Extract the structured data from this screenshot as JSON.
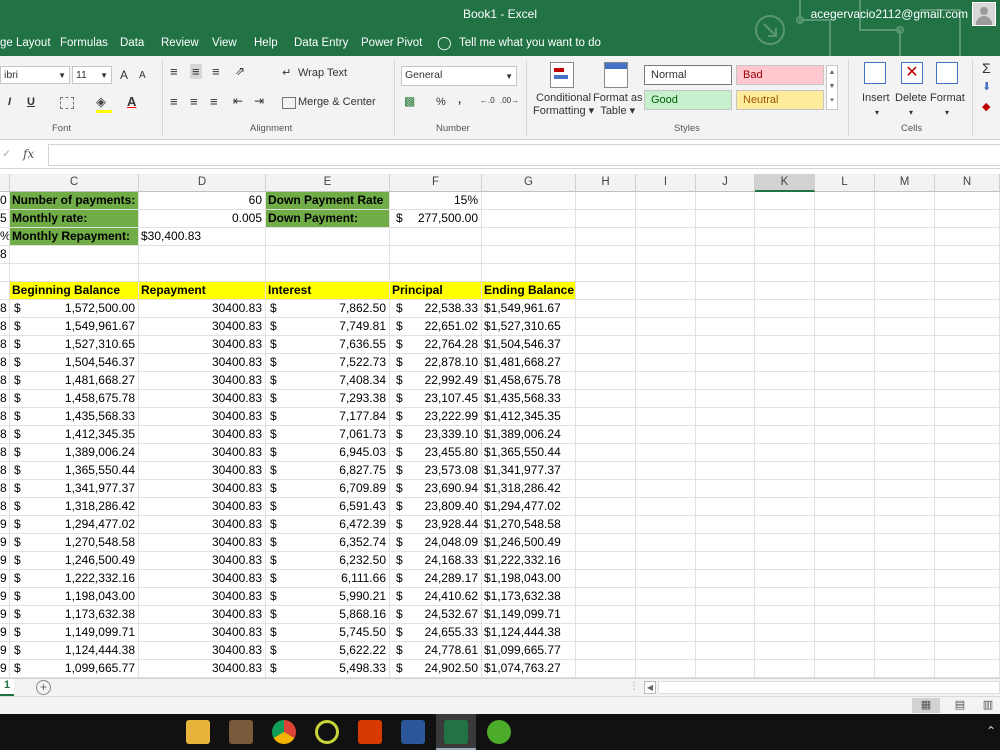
{
  "window": {
    "title": "Book1  -  Excel",
    "account": "acegervacio2112@gmail.com"
  },
  "tabs": [
    {
      "label": "ge Layout"
    },
    {
      "label": "Formulas"
    },
    {
      "label": "Data"
    },
    {
      "label": "Review"
    },
    {
      "label": "View"
    },
    {
      "label": "Help"
    },
    {
      "label": "Data Entry"
    },
    {
      "label": "Power Pivot"
    }
  ],
  "tell_me": "Tell me what you want to do",
  "ribbon": {
    "font_name": "ibri",
    "font_size": "11",
    "grow_font": "A",
    "shrink_font": "A",
    "bold": "I",
    "underline": "U",
    "wrap_text": "Wrap Text",
    "merge_center": "Merge & Center",
    "number_format": "General",
    "percent": "%",
    "comma": ",",
    "conditional_formatting": [
      "Conditional",
      "Formatting"
    ],
    "format_as_table": [
      "Format as",
      "Table"
    ],
    "styles": {
      "normal": "Normal",
      "bad": "Bad",
      "good": "Good",
      "neutral": "Neutral"
    },
    "insert": "Insert",
    "delete": "Delete",
    "format": "Format",
    "groups": {
      "font": "Font",
      "alignment": "Alignment",
      "number": "Number",
      "styles": "Styles",
      "cells": "Cells"
    }
  },
  "formula_bar": {
    "fx": "fx",
    "content": ""
  },
  "columns": [
    "C",
    "D",
    "E",
    "F",
    "G",
    "H",
    "I",
    "J",
    "K",
    "L",
    "M",
    "N"
  ],
  "selected_column": "K",
  "info": {
    "row1": {
      "b_tail": "0",
      "c": "Number of payments:",
      "d": "60",
      "e": "Down Payment Rate",
      "f": "15%"
    },
    "row2": {
      "b_tail": "5",
      "c": "Monthly rate:",
      "d": "0.005",
      "e": "Down Payment:",
      "f_sym": "$",
      "f": "277,500.00"
    },
    "row3": {
      "b_tail": "%",
      "c": "Monthly Repayment:",
      "d": "$30,400.83"
    },
    "row4": {
      "b_tail": "8"
    }
  },
  "table": {
    "headers": {
      "c": "Beginning Balance",
      "d": "Repayment",
      "e": "Interest",
      "f": "Principal",
      "g": "Ending Balance"
    },
    "rows": [
      {
        "b": "8",
        "begin": "1,572,500.00",
        "repay": "30400.83",
        "interest": "7,862.50",
        "principal": "22,538.33",
        "end": "$1,549,961.67"
      },
      {
        "b": "8",
        "begin": "1,549,961.67",
        "repay": "30400.83",
        "interest": "7,749.81",
        "principal": "22,651.02",
        "end": "$1,527,310.65"
      },
      {
        "b": "8",
        "begin": "1,527,310.65",
        "repay": "30400.83",
        "interest": "7,636.55",
        "principal": "22,764.28",
        "end": "$1,504,546.37"
      },
      {
        "b": "8",
        "begin": "1,504,546.37",
        "repay": "30400.83",
        "interest": "7,522.73",
        "principal": "22,878.10",
        "end": "$1,481,668.27"
      },
      {
        "b": "8",
        "begin": "1,481,668.27",
        "repay": "30400.83",
        "interest": "7,408.34",
        "principal": "22,992.49",
        "end": "$1,458,675.78"
      },
      {
        "b": "8",
        "begin": "1,458,675.78",
        "repay": "30400.83",
        "interest": "7,293.38",
        "principal": "23,107.45",
        "end": "$1,435,568.33"
      },
      {
        "b": "8",
        "begin": "1,435,568.33",
        "repay": "30400.83",
        "interest": "7,177.84",
        "principal": "23,222.99",
        "end": "$1,412,345.35"
      },
      {
        "b": "8",
        "begin": "1,412,345.35",
        "repay": "30400.83",
        "interest": "7,061.73",
        "principal": "23,339.10",
        "end": "$1,389,006.24"
      },
      {
        "b": "8",
        "begin": "1,389,006.24",
        "repay": "30400.83",
        "interest": "6,945.03",
        "principal": "23,455.80",
        "end": "$1,365,550.44"
      },
      {
        "b": "8",
        "begin": "1,365,550.44",
        "repay": "30400.83",
        "interest": "6,827.75",
        "principal": "23,573.08",
        "end": "$1,341,977.37"
      },
      {
        "b": "8",
        "begin": "1,341,977.37",
        "repay": "30400.83",
        "interest": "6,709.89",
        "principal": "23,690.94",
        "end": "$1,318,286.42"
      },
      {
        "b": "8",
        "begin": "1,318,286.42",
        "repay": "30400.83",
        "interest": "6,591.43",
        "principal": "23,809.40",
        "end": "$1,294,477.02"
      },
      {
        "b": "9",
        "begin": "1,294,477.02",
        "repay": "30400.83",
        "interest": "6,472.39",
        "principal": "23,928.44",
        "end": "$1,270,548.58"
      },
      {
        "b": "9",
        "begin": "1,270,548.58",
        "repay": "30400.83",
        "interest": "6,352.74",
        "principal": "24,048.09",
        "end": "$1,246,500.49"
      },
      {
        "b": "9",
        "begin": "1,246,500.49",
        "repay": "30400.83",
        "interest": "6,232.50",
        "principal": "24,168.33",
        "end": "$1,222,332.16"
      },
      {
        "b": "9",
        "begin": "1,222,332.16",
        "repay": "30400.83",
        "interest": "6,111.66",
        "principal": "24,289.17",
        "end": "$1,198,043.00"
      },
      {
        "b": "9",
        "begin": "1,198,043.00",
        "repay": "30400.83",
        "interest": "5,990.21",
        "principal": "24,410.62",
        "end": "$1,173,632.38"
      },
      {
        "b": "9",
        "begin": "1,173,632.38",
        "repay": "30400.83",
        "interest": "5,868.16",
        "principal": "24,532.67",
        "end": "$1,149,099.71"
      },
      {
        "b": "9",
        "begin": "1,149,099.71",
        "repay": "30400.83",
        "interest": "5,745.50",
        "principal": "24,655.33",
        "end": "$1,124,444.38"
      },
      {
        "b": "9",
        "begin": "1,124,444.38",
        "repay": "30400.83",
        "interest": "5,622.22",
        "principal": "24,778.61",
        "end": "$1,099,665.77"
      },
      {
        "b": "9",
        "begin": "1,099,665.77",
        "repay": "30400.83",
        "interest": "5,498.33",
        "principal": "24,902.50",
        "end": "$1,074,763.27"
      }
    ]
  },
  "currency_symbol": "$",
  "sheet_tab": "1",
  "add_sheet": "+",
  "taskbar_icons": [
    "file-explorer-icon",
    "app-icon",
    "chrome-icon",
    "media-player-icon",
    "office-icon",
    "word-icon",
    "excel-icon",
    "utorrent-icon"
  ],
  "colors": {
    "excel_green": "#217346",
    "header_green": "#70ad47",
    "header_yellow": "#ffff00"
  }
}
